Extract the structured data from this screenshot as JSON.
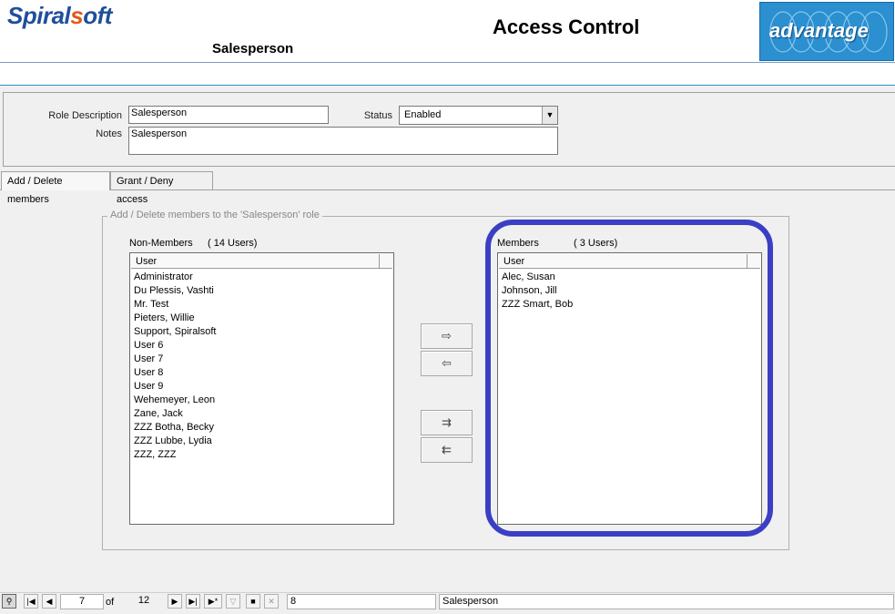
{
  "header": {
    "logo_prefix": "Spiral",
    "logo_o": "s",
    "logo_suffix": "oft",
    "app_title": "Access Control",
    "role_title": "Salesperson",
    "brand_badge": "advantage"
  },
  "form": {
    "role_description_label": "Role Description",
    "role_description_value": "Salesperson",
    "status_label": "Status",
    "status_value": "Enabled",
    "notes_label": "Notes",
    "notes_value": "Salesperson"
  },
  "tabs": [
    {
      "label": "Add / Delete members"
    },
    {
      "label": "Grant / Deny access"
    }
  ],
  "group": {
    "legend": "Add / Delete members to the 'Salesperson' role",
    "non_members": {
      "label": "Non-Members",
      "count": "( 14 Users)",
      "column": "User",
      "rows": [
        "Administrator",
        "Du Plessis, Vashti",
        "Mr. Test",
        "Pieters, Willie",
        "Support, Spiralsoft",
        "User 6",
        "User 7",
        "User 8",
        "User 9",
        "Wehemeyer, Leon",
        "Zane, Jack",
        "ZZZ Botha, Becky",
        "ZZZ Lubbe, Lydia",
        "ZZZ, ZZZ"
      ]
    },
    "members": {
      "label": "Members",
      "count": "( 3 Users)",
      "column": "User",
      "rows": [
        "Alec, Susan",
        "Johnson, Jill",
        "ZZZ Smart, Bob"
      ]
    },
    "buttons": {
      "add_one": "⇨",
      "remove_one": "⇦",
      "add_all": "⇉",
      "remove_all": "⇇"
    }
  },
  "statusbar": {
    "current_record": "7",
    "of_label": "of",
    "total_records": "12",
    "field_value": "8",
    "role_value": "Salesperson"
  },
  "colors": {
    "highlight": "#3a3fc4",
    "brand_blue": "#1f4e9c",
    "brand_orange": "#e05a1a"
  }
}
